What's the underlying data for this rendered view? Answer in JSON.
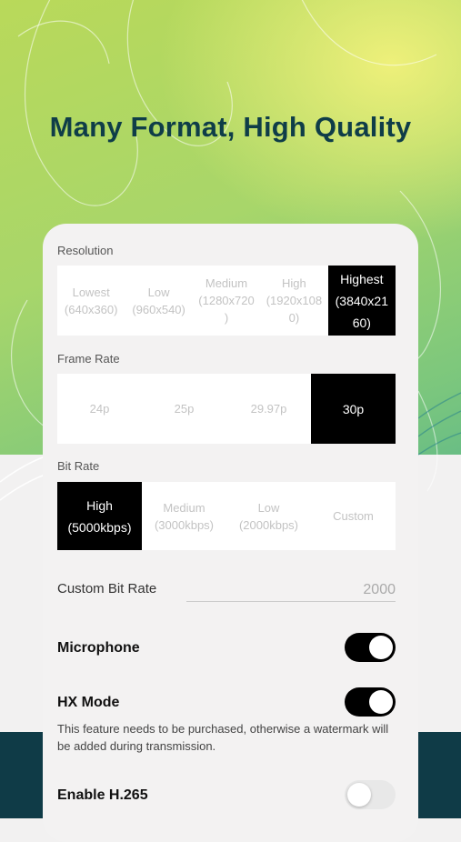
{
  "headline": "Many Format, High Quality",
  "resolution": {
    "label": "Resolution",
    "options": [
      "Lowest\n(640x360)",
      "Low\n(960x540)",
      "Medium\n(1280x720\n)",
      "High\n(1920x108\n0)",
      "Highest\n(3840x21\n60)"
    ],
    "selected_index": 4
  },
  "frame_rate": {
    "label": "Frame Rate",
    "options": [
      "24p",
      "25p",
      "29.97p",
      "30p"
    ],
    "selected_index": 3
  },
  "bit_rate": {
    "label": "Bit Rate",
    "options": [
      "High\n(5000kbps)",
      "Medium\n(3000kbps)",
      "Low\n(2000kbps)",
      "Custom"
    ],
    "selected_index": 0
  },
  "custom_bit_rate": {
    "label": "Custom Bit Rate",
    "value": "2000"
  },
  "microphone": {
    "label": "Microphone",
    "enabled": true
  },
  "hx_mode": {
    "label": "HX Mode",
    "enabled": true,
    "note": "This feature needs to be purchased, otherwise a watermark will be added during transmission."
  },
  "h265": {
    "label": "Enable H.265",
    "enabled": false
  },
  "colors": {
    "accent": "#000000",
    "headline": "#0f3d48",
    "dark_band": "#0f3b47"
  }
}
